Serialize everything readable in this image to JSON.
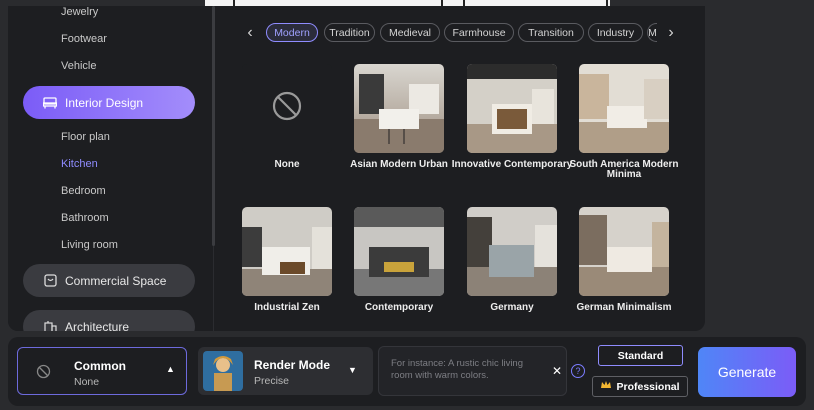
{
  "sidebar": {
    "sub_top": [
      "Jewelry",
      "Footwear",
      "Vehicle"
    ],
    "active_category": "Interior Design",
    "sub_interior": [
      "Floor plan",
      "Kitchen",
      "Bedroom",
      "Bathroom",
      "Living room"
    ],
    "active_sub": "Kitchen",
    "categories_below": [
      "Commercial Space",
      "Architecture"
    ]
  },
  "tabs": [
    "Modern",
    "Tradition",
    "Medieval",
    "Farmhouse",
    "Transition",
    "Industry",
    "M"
  ],
  "active_tab": "Modern",
  "styles": [
    "None",
    "Asian Modern Urban",
    "Innovative Contemporary",
    "South America Modern Minima",
    "Industrial Zen",
    "Contemporary",
    "Germany",
    "German Minimalism"
  ],
  "bottom": {
    "common_title": "Common",
    "common_value": "None",
    "render_title": "Render Mode",
    "render_value": "Precise",
    "prompt_placeholder": "For instance: A rustic chic living room with warm colors.",
    "standard_label": "Standard",
    "professional_label": "Professional",
    "generate_label": "Generate"
  },
  "colors": {
    "accent": "#8f8cff",
    "category_active": "#7b5cf7",
    "generate_gradient": [
      "#4f86f7",
      "#7b5cf7"
    ]
  }
}
